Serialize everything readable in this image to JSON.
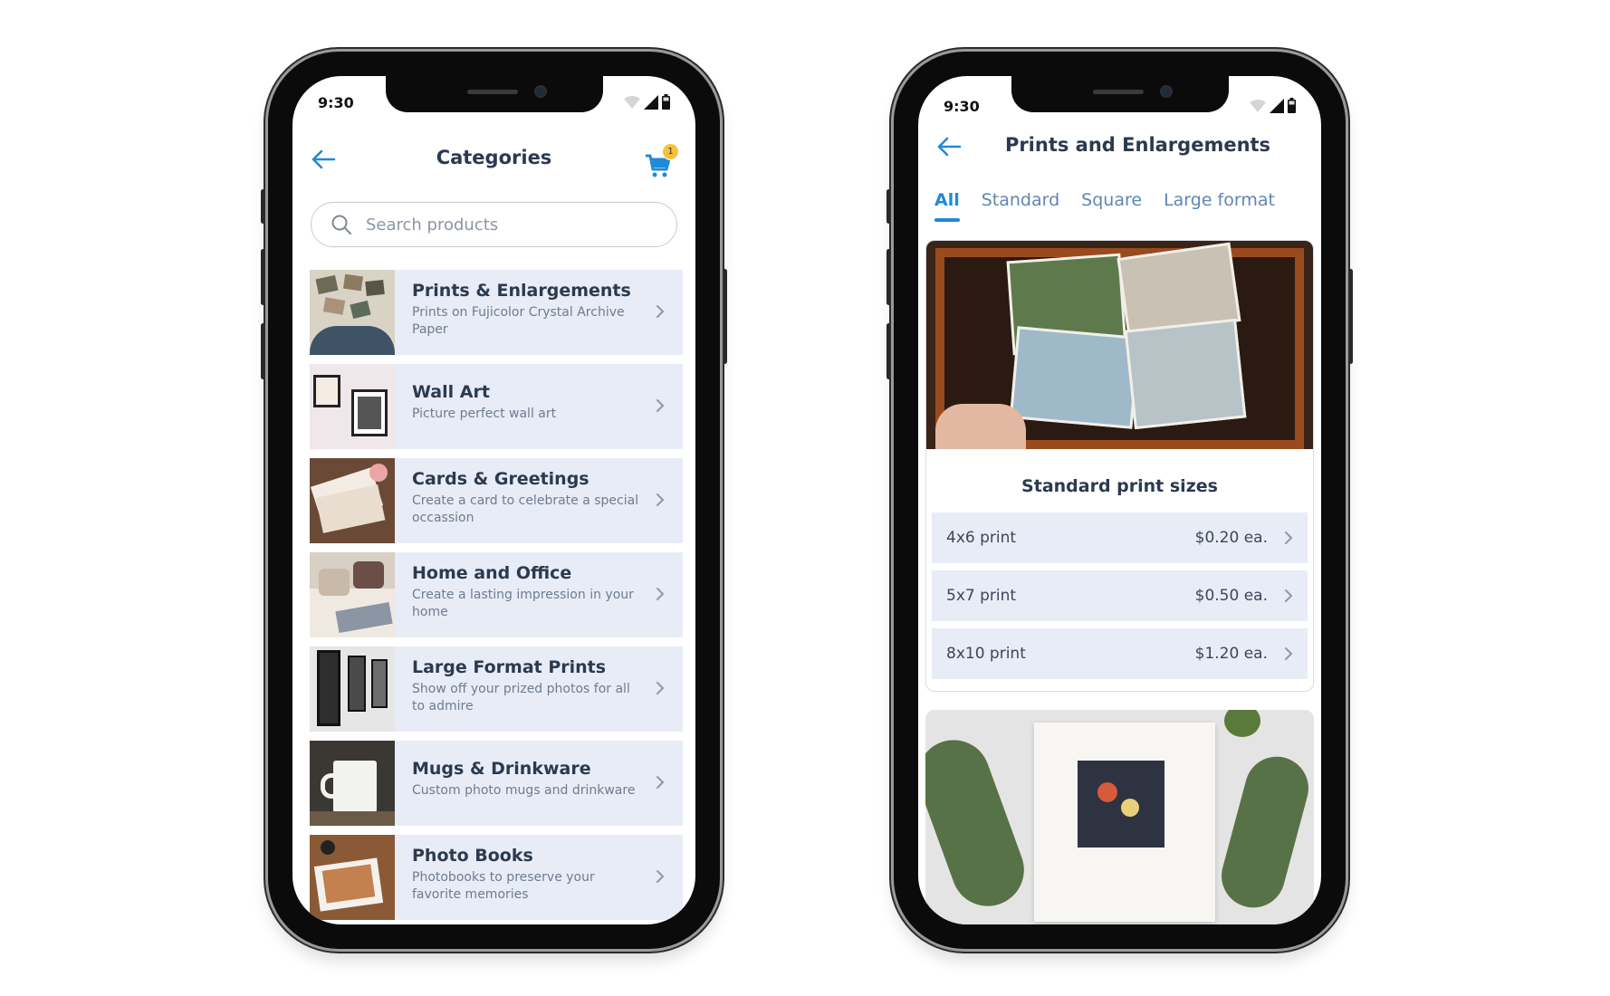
{
  "status": {
    "time_left": "9:30",
    "time_right": "9:30"
  },
  "categories_screen": {
    "title": "Categories",
    "cart_count": "1",
    "search_placeholder": "Search products",
    "items": [
      {
        "title": "Prints & Enlargements",
        "subtitle": "Prints on Fujicolor Crystal Archive Paper"
      },
      {
        "title": "Wall Art",
        "subtitle": "Picture perfect wall art"
      },
      {
        "title": "Cards & Greetings",
        "subtitle": "Create a card to celebrate a special occassion"
      },
      {
        "title": "Home and Office",
        "subtitle": "Create a lasting impression in your home"
      },
      {
        "title": "Large Format Prints",
        "subtitle": "Show off your prized photos for all to admire"
      },
      {
        "title": "Mugs & Drinkware",
        "subtitle": "Custom photo mugs and drinkware"
      },
      {
        "title": "Photo Books",
        "subtitle": "Photobooks to preserve your favorite memories"
      }
    ]
  },
  "prints_screen": {
    "title": "Prints and Enlargements",
    "tabs": [
      "All",
      "Standard",
      "Square",
      "Large format"
    ],
    "active_tab": "All",
    "section_title": "Standard print sizes",
    "sizes": [
      {
        "name": "4x6 print",
        "price": "$0.20 ea."
      },
      {
        "name": "5x7 print",
        "price": "$0.50 ea."
      },
      {
        "name": "8x10 print",
        "price": "$1.20 ea."
      }
    ]
  },
  "colors": {
    "accent": "#1f8ad6",
    "row_bg": "#e7ecf7",
    "badge": "#f4c338"
  }
}
